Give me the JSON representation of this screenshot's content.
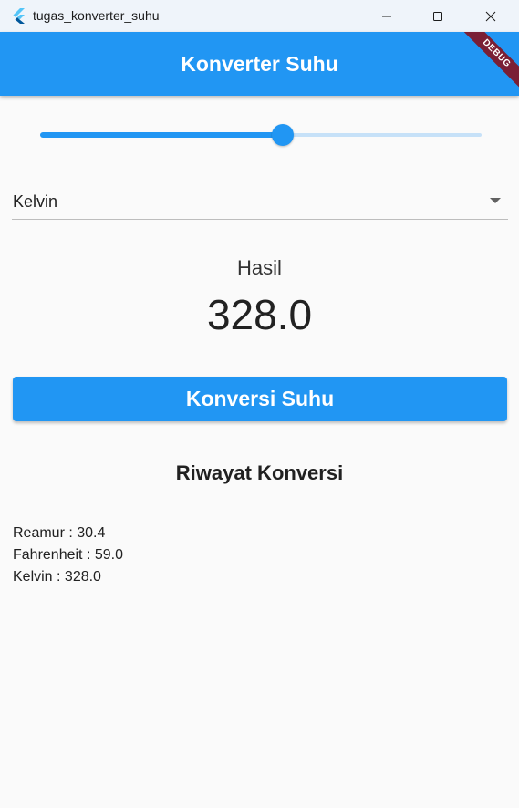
{
  "window": {
    "title": "tugas_konverter_suhu",
    "icon": "flutter-logo-icon"
  },
  "app_bar": {
    "title": "Konverter Suhu",
    "color": "#2196f3",
    "debug_banner": "DEBUG"
  },
  "slider": {
    "fill_fraction": 0.55
  },
  "dropdown": {
    "selected": "Kelvin"
  },
  "result": {
    "label": "Hasil",
    "value": "328.0"
  },
  "convert_button": {
    "label": "Konversi Suhu"
  },
  "history": {
    "title": "Riwayat Konversi",
    "items": [
      "Reamur : 30.4",
      "Fahrenheit : 59.0",
      "Kelvin : 328.0"
    ]
  }
}
